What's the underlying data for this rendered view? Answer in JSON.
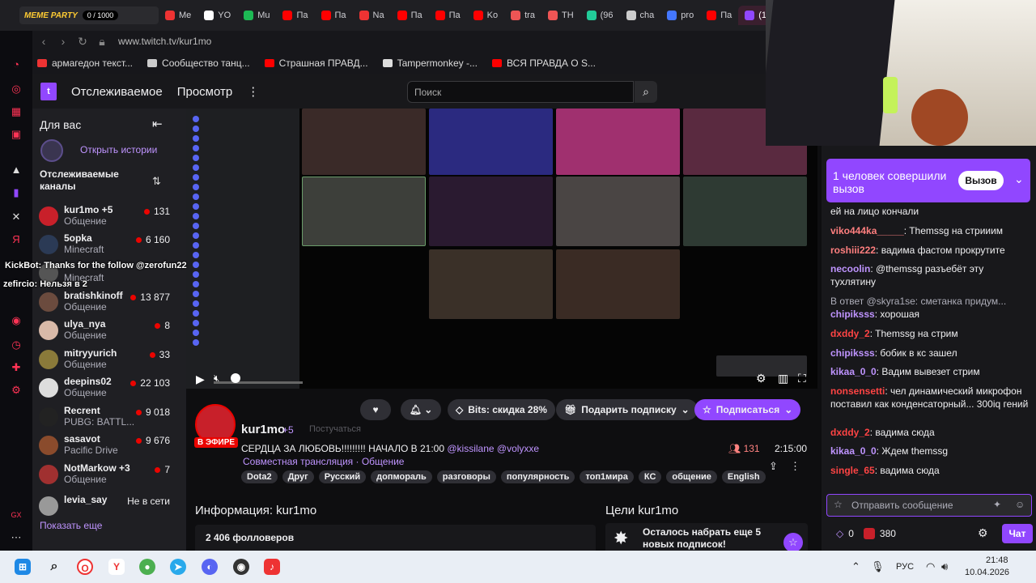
{
  "browser": {
    "gx_widget": {
      "label": "MEME PARTY",
      "counter": "0 / 1000"
    },
    "tabs": [
      {
        "label": "Me",
        "color": "#e33"
      },
      {
        "label": "YO",
        "color": "#fff"
      },
      {
        "label": "Mu",
        "color": "#1db954"
      },
      {
        "label": "Па",
        "color": "#f00"
      },
      {
        "label": "Па",
        "color": "#f00"
      },
      {
        "label": "Na",
        "color": "#e33"
      },
      {
        "label": "Па",
        "color": "#f00"
      },
      {
        "label": "Па",
        "color": "#f00"
      },
      {
        "label": "Ko",
        "color": "#f00"
      },
      {
        "label": "tra",
        "color": "#e55"
      },
      {
        "label": "TH",
        "color": "#e55"
      },
      {
        "label": "(96",
        "color": "#2c9"
      },
      {
        "label": "cha",
        "color": "#ccc"
      },
      {
        "label": "pro",
        "color": "#47f"
      },
      {
        "label": "Па",
        "color": "#f00"
      },
      {
        "label": "(1)",
        "color": "#9147ff",
        "active": true
      }
    ],
    "url": "www.twitch.tv/kur1mo",
    "bookmarks": [
      {
        "label": "армагедон текст...",
        "color": "#e33"
      },
      {
        "label": "Сообщество танц...",
        "color": "#ccc"
      },
      {
        "label": "Страшная ПРАВД...",
        "color": "#f00"
      },
      {
        "label": "Tampermonkey -...",
        "color": "#ddd"
      },
      {
        "label": "ВСЯ ПРАВДА О S...",
        "color": "#f00"
      }
    ]
  },
  "twitch_header": {
    "following": "Отслеживаемое",
    "browse": "Просмотр",
    "more": "⋮",
    "search_placeholder": "Поиск"
  },
  "sidebar": {
    "for_you": "Для вас",
    "stories": "Открыть истории",
    "followed_channels": "Отслеживаемые каналы",
    "channels": [
      {
        "name": "kur1mo +5",
        "game": "Общение",
        "viewers": "131",
        "color": "#c8202a"
      },
      {
        "name": "5opka",
        "game": "Minecraft",
        "viewers": "6 160",
        "color": "#2b3a55"
      },
      {
        "name": "",
        "game": "Minecraft",
        "viewers": "",
        "color": "#555"
      },
      {
        "name": "bratishkinoff",
        "game": "Общение",
        "viewers": "13 877",
        "color": "#6b4b3e"
      },
      {
        "name": "ulya_nya",
        "game": "Общение",
        "viewers": "8",
        "color": "#d8b9a8"
      },
      {
        "name": "mitryyurich",
        "game": "Общение",
        "viewers": "33",
        "color": "#8a7a3a"
      },
      {
        "name": "deepins02",
        "game": "Общение",
        "viewers": "22 103",
        "color": "#ddd"
      },
      {
        "name": "Recrent",
        "game": "PUBG: BATTL...",
        "viewers": "9 018",
        "color": "#222"
      },
      {
        "name": "sasavot",
        "game": "Pacific Drive",
        "viewers": "9 676",
        "color": "#8a4b2c"
      },
      {
        "name": "NotMarkow +3",
        "game": "Общение",
        "viewers": "7",
        "color": "#a03030"
      },
      {
        "name": "levia_say",
        "game": "",
        "viewers": "",
        "color": "#999",
        "offline": "Не в сети"
      }
    ],
    "show_more": "Показать еще"
  },
  "overlay": {
    "line1": "KickBot: Thanks for the follow @zerofun22",
    "line2": "zefircio: Нельзя в 2"
  },
  "stream": {
    "live_badge": "В ЭФИРЕ",
    "channel": "kur1mo",
    "plus": "+5",
    "following_btn": "Постучаться",
    "title": "СЕРДЦА ЗА ЛЮБОВЬ!!!!!!!!! НАЧАЛО В 21:00 ",
    "mention1": "@kissilane",
    "mention2": "@volyxxe",
    "collab": "Совместная трансляция · Общение",
    "tags": [
      "Dota2",
      "Друг",
      "Русский",
      "допмораль",
      "разговоры",
      "популярность",
      "топ1мира",
      "КС",
      "общение",
      "English"
    ],
    "viewers": "131",
    "uptime": "2:15:00",
    "bits": "Bits: скидка 28%",
    "gift_sub": "Подарить подписку",
    "subscribe": "Подписаться",
    "about_title": "Информация: kur1mo",
    "followers": "2 406 фолловеров",
    "goals_title": "Цели kur1mo",
    "goals_text": "Осталось набрать еще 5 новых подписок!"
  },
  "chat": {
    "callout_text": "1 человек совершили вызов",
    "callout_btn": "Вызов",
    "messages": [
      {
        "user": "",
        "text": "ей на лицо кончали",
        "color": "#efeff1"
      },
      {
        "user": "viko444ka_____",
        "text": ": Themssg на стрииим",
        "color": "#ff7f7f"
      },
      {
        "user": "roshiii222",
        "text": ": вадима фастом прокрутите",
        "color": "#ff7f7f"
      },
      {
        "user": "necoolin",
        "text": ": @themssg разъебёт эту тухлятину",
        "color": "#bf94ff"
      },
      {
        "user": "",
        "text": "В ответ @skyra1se: сметанка придум...",
        "color": "#adadb8"
      },
      {
        "user": "chipiksss",
        "text": ": хорошая",
        "color": "#bf94ff"
      },
      {
        "user": "dxddy_2",
        "text": ": Themssg на стрим",
        "color": "#ff4444"
      },
      {
        "user": "chipiksss",
        "text": ": бобик в кс зашел",
        "color": "#bf94ff"
      },
      {
        "user": "kikaa_0_0",
        "text": ": Вадим вывезет стрим",
        "color": "#bf94ff"
      },
      {
        "user": "nonsensetti",
        "text": ": чел динамический микрофон поставил как конденсаторный... 300iq гений",
        "color": "#ff4444"
      },
      {
        "user": "dxddy_2",
        "text": ": вадима сюда",
        "color": "#ff4444"
      },
      {
        "user": "kikaa_0_0",
        "text": ": Ждем themssg",
        "color": "#bf94ff"
      },
      {
        "user": "single_65",
        "text": ": вадима сюда",
        "color": "#ff4444"
      }
    ],
    "input_placeholder": "Отправить сообщение",
    "points": "380",
    "bits": "0",
    "send": "Чат"
  },
  "taskbar": {
    "lang": "РУС",
    "time": "21:48",
    "date": "10.04.2026"
  }
}
